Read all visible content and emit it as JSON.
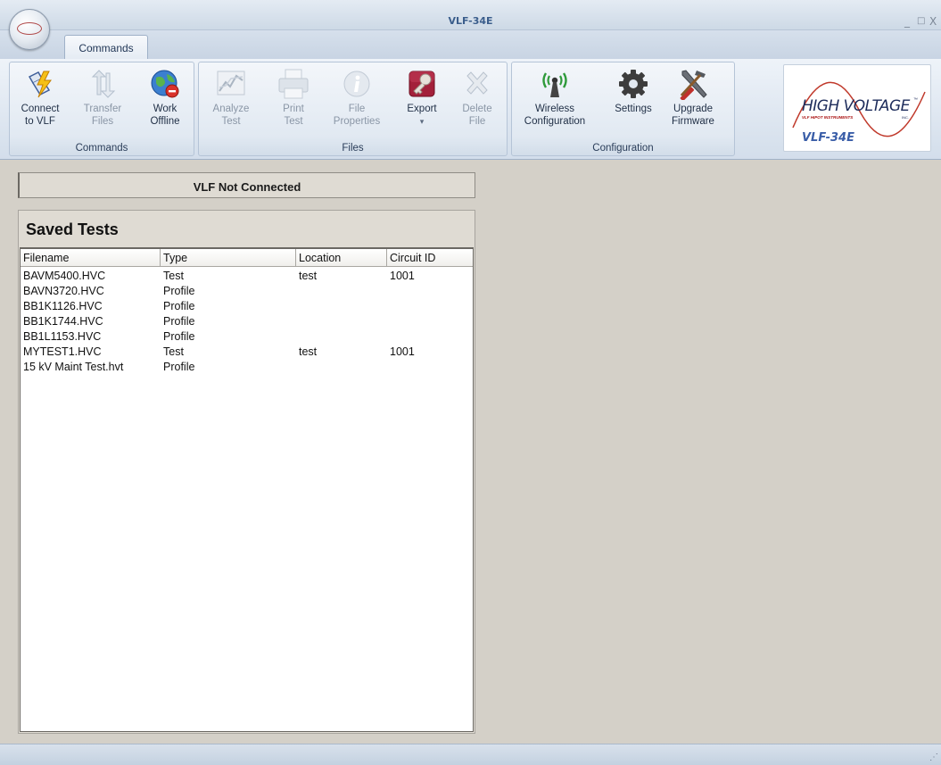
{
  "window": {
    "title": "VLF-34E",
    "minimize": "_",
    "maximize": "□",
    "close": "X"
  },
  "ribbon": {
    "tab": "Commands",
    "groups": [
      {
        "label": "Commands",
        "buttons": [
          {
            "label": "Connect\nto VLF",
            "icon": "lightning-connect-icon",
            "enabled": true
          },
          {
            "label": "Transfer\nFiles",
            "icon": "transfer-arrows-icon",
            "enabled": false
          },
          {
            "label": "Work\nOffline",
            "icon": "globe-offline-icon",
            "enabled": true
          }
        ]
      },
      {
        "label": "Files",
        "buttons": [
          {
            "label": "Analyze\nTest",
            "icon": "chart-icon",
            "enabled": false
          },
          {
            "label": "Print\nTest",
            "icon": "printer-icon",
            "enabled": false
          },
          {
            "label": "File\nProperties",
            "icon": "info-icon",
            "enabled": false
          },
          {
            "label": "Export",
            "icon": "export-key-icon",
            "enabled": true,
            "dropdown": "▾"
          },
          {
            "label": "Delete\nFile",
            "icon": "delete-x-icon",
            "enabled": false
          }
        ]
      },
      {
        "label": "Configuration",
        "buttons": [
          {
            "label": "Wireless\nConfiguration",
            "icon": "wireless-antenna-icon",
            "enabled": true
          },
          {
            "label": "Settings",
            "icon": "gear-icon",
            "enabled": true
          },
          {
            "label": "Upgrade\nFirmware",
            "icon": "hammer-wrench-icon",
            "enabled": true
          }
        ]
      }
    ]
  },
  "logo": {
    "main": "HIGH VOLTAGE",
    "tm": "™",
    "sub": "VLF HIPOT INSTRUMENTS",
    "inc": "INC.",
    "model": "VLF-34E"
  },
  "connection_status": "VLF Not Connected",
  "saved_tests": {
    "title": "Saved Tests",
    "columns": [
      "Filename",
      "Type",
      "Location",
      "Circuit ID"
    ],
    "rows": [
      [
        "BAVM5400.HVC",
        "Test",
        "test",
        "1001"
      ],
      [
        "BAVN3720.HVC",
        "Profile",
        "",
        ""
      ],
      [
        "BB1K1126.HVC",
        "Profile",
        "",
        ""
      ],
      [
        "BB1K1744.HVC",
        "Profile",
        "",
        ""
      ],
      [
        "BB1L1153.HVC",
        "Profile",
        "",
        ""
      ],
      [
        "MYTEST1.HVC",
        "Test",
        "test",
        "1001"
      ],
      [
        "15 kV Maint Test.hvt",
        "Profile",
        "",
        ""
      ]
    ]
  },
  "colors": {
    "accent": "#3b5e8c",
    "logo_red": "#c0392b",
    "logo_blue": "#3a5ea8"
  }
}
